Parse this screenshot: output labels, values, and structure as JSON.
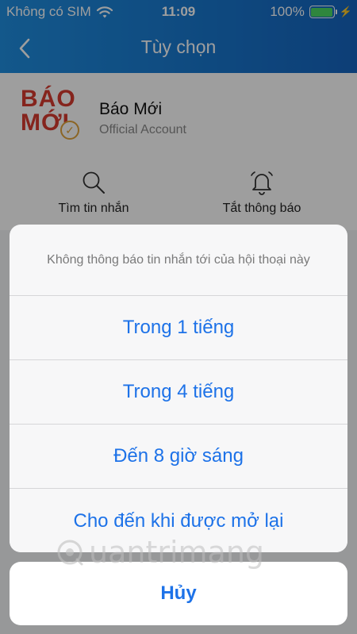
{
  "status_bar": {
    "carrier": "Không có SIM",
    "time": "11:09",
    "battery": "100%"
  },
  "nav": {
    "title": "Tùy chọn",
    "back_icon": "chevron-left-icon"
  },
  "profile": {
    "logo_line1": "BÁO",
    "logo_line2": "MỚI",
    "name": "Báo Mới",
    "subtitle": "Official Account"
  },
  "actions": [
    {
      "label": "Tìm tin nhắn",
      "icon": "search-icon"
    },
    {
      "label": "Tắt thông báo",
      "icon": "bell-icon"
    }
  ],
  "sheet": {
    "title": "Không thông báo tin nhắn tới của hội thoại này",
    "options": [
      "Trong 1 tiếng",
      "Trong 4 tiếng",
      "Đến 8 giờ sáng",
      "Cho đến khi được mở lại"
    ],
    "cancel": "Hủy"
  },
  "watermark": "uantrimang",
  "colors": {
    "header": "#1876cd",
    "option_text": "#1d72e8",
    "battery_fill": "#4cd964",
    "logo_red": "#d73b2f"
  }
}
